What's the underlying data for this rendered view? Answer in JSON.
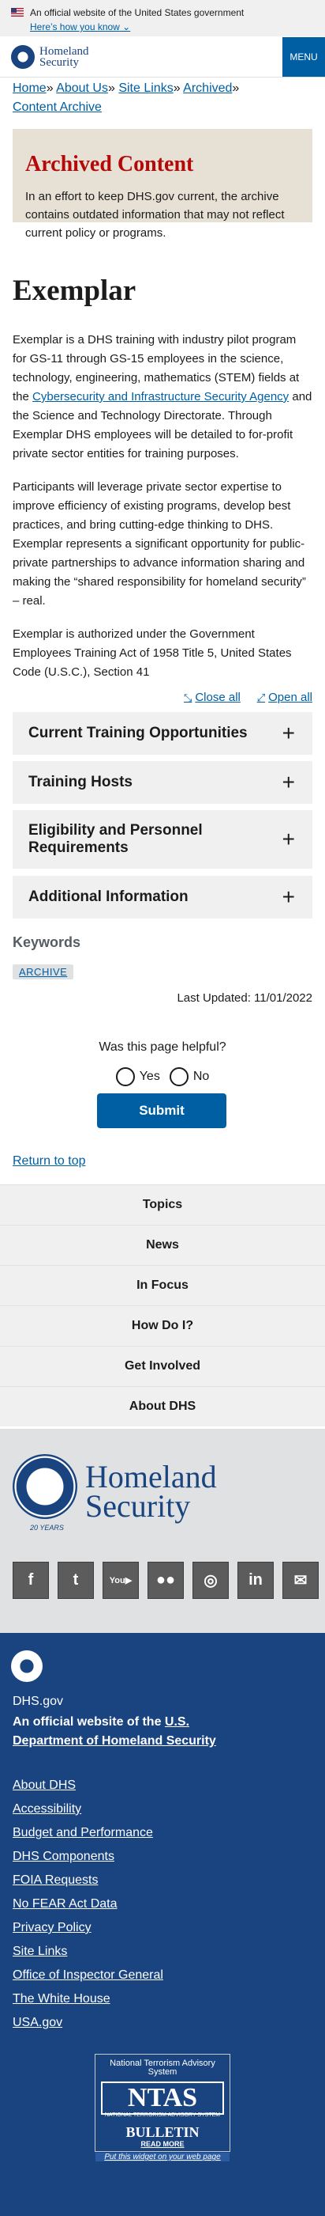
{
  "banner": {
    "text": "An official website of the United States government",
    "howknow": "Here’s how you know"
  },
  "header": {
    "logo_line1": "Homeland",
    "logo_line2": "Security",
    "menu": "MENU"
  },
  "breadcrumb": [
    "Home",
    "About Us",
    "Site Links",
    "Archived",
    "Content Archive"
  ],
  "archived": {
    "title": "Archived Content",
    "text": "In an effort to keep DHS.gov current, the archive contains outdated information that may not reflect current policy or programs."
  },
  "page": {
    "title": "Exemplar",
    "p1_a": "Exemplar is a DHS training with industry pilot program for GS-11 through GS-15 employees in the science, technology, engineering, mathematics (STEM) fields at the ",
    "p1_link": "Cybersecurity and Infrastructure Security Agency",
    "p1_b": " and the Science and Technology Directorate. Through Exemplar DHS employees will be detailed to for-profit private sector entities for training purposes.",
    "p2": "Participants will leverage private sector expertise to improve efficiency of existing programs, develop best practices, and bring cutting-edge thinking to DHS. Exemplar represents a significant opportunity for public-private partnerships to advance information sharing and making the “shared responsibility for homeland security” – real.",
    "p3": "Exemplar is authorized under the Government Employees Training Act of 1958 Title 5, United States Code (U.S.C.), Section 41"
  },
  "accordion": {
    "close_all": "Close all",
    "open_all": "Open all",
    "items": [
      "Current Training Opportunities",
      "Training Hosts",
      "Eligibility and Personnel Requirements",
      "Additional Information"
    ]
  },
  "keywords": {
    "heading": "Keywords",
    "tag": "ARCHIVE"
  },
  "last_updated": "Last Updated: 11/01/2022",
  "feedback": {
    "question": "Was this page helpful?",
    "yes": "Yes",
    "no": "No",
    "submit": "Submit"
  },
  "return_top": "Return to top",
  "footer_nav": [
    "Topics",
    "News",
    "In Focus",
    "How Do I?",
    "Get Involved",
    "About DHS"
  ],
  "footer_logo": {
    "line1": "Homeland",
    "line2": "Security",
    "caption": "20 YEARS"
  },
  "social": [
    "facebook-icon",
    "twitter-icon",
    "youtube-icon",
    "flickr-icon",
    "instagram-icon",
    "linkedin-icon",
    "email-icon"
  ],
  "footer": {
    "domain": "DHS.gov",
    "official_a": "An official website of the ",
    "official_link": "U.S. Department of Homeland Security",
    "links": [
      "About DHS",
      "Accessibility",
      "Budget and Performance",
      "DHS Components",
      "FOIA Requests",
      "No FEAR Act Data",
      "Privacy Policy",
      "Site Links",
      "Office of Inspector General",
      "The White House",
      "USA.gov"
    ]
  },
  "ntas": {
    "top": "National Terrorism Advisory System",
    "logo": "NTAS",
    "sub": "NATIONAL TERRORISM ADVISORY SYSTEM",
    "bulletin": "BULLETIN",
    "read_more": "READ MORE",
    "put": "Put this widget on your web page"
  }
}
